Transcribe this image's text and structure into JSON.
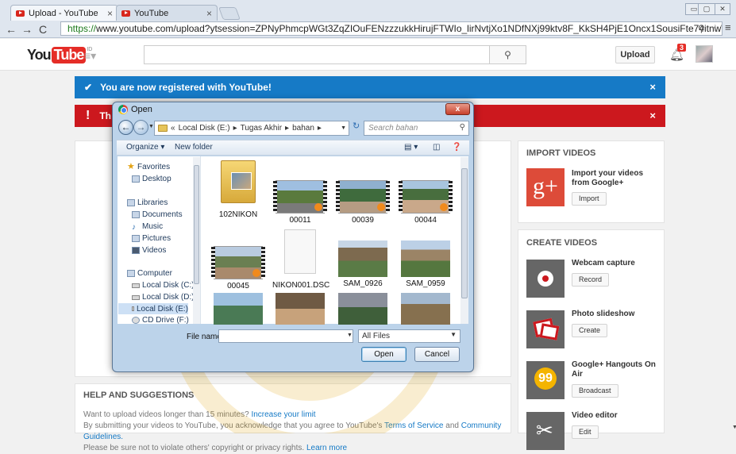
{
  "browser": {
    "tabs": [
      {
        "title": "Upload - YouTube",
        "active": true
      },
      {
        "title": "YouTube",
        "active": false
      }
    ],
    "url_https": "https://",
    "url_rest": "www.youtube.com/upload?ytsession=ZPNyPhmcpWGt3ZqZIOuFENzzzukkHirujFTWIo_lirNvtjXo1NDfNXj99ktv8F_KkSH4PjE1Oncx1SousiFte74itnwWRAR9_dBNI",
    "window_controls": [
      "▭",
      "▢",
      "✕"
    ]
  },
  "youtube": {
    "logo_you": "You",
    "logo_tube": "Tube",
    "logo_country": "ID",
    "search_placeholder": "",
    "upload_label": "Upload",
    "notification_count": "3"
  },
  "banners": {
    "registered": "You are now registered with YouTube!",
    "warning_visible": "Th"
  },
  "import": {
    "title": "IMPORT VIDEOS",
    "gplus_title": "Import your videos from Google+",
    "gplus_button": "Import"
  },
  "create": {
    "title": "CREATE VIDEOS",
    "items": [
      {
        "title": "Webcam capture",
        "button": "Record"
      },
      {
        "title": "Photo slideshow",
        "button": "Create"
      },
      {
        "title": "Google+ Hangouts On Air",
        "button": "Broadcast"
      },
      {
        "title": "Video editor",
        "button": "Edit"
      }
    ]
  },
  "help": {
    "title": "HELP AND SUGGESTIONS",
    "line1_text": "Want to upload videos longer than 15 minutes?",
    "line1_link": "Increase your limit",
    "line2_text": "By submitting your videos to YouTube, you acknowledge that you agree to YouTube's",
    "line2_link1": "Terms of Service",
    "line2_and": "and",
    "line2_link2": "Community Guidelines.",
    "line3_text": "Please be sure not to violate others' copyright or privacy rights.",
    "line3_link": "Learn more"
  },
  "dialog": {
    "title": "Open",
    "close": "x",
    "path": [
      "Local Disk (E:)",
      "Tugas Akhir",
      "bahan"
    ],
    "search_placeholder": "Search bahan",
    "organize": "Organize ▾",
    "new_folder": "New folder",
    "nav": {
      "favorites": "Favorites",
      "desktop": "Desktop",
      "libraries": "Libraries",
      "documents": "Documents",
      "music": "Music",
      "pictures": "Pictures",
      "videos": "Videos",
      "computer": "Computer",
      "drive_c": "Local Disk (C:)",
      "drive_d": "Local Disk (D:)",
      "drive_e": "Local Disk (E:)",
      "drive_f": "CD Drive (F:)"
    },
    "files": [
      "102NIKON",
      "00011",
      "00039",
      "00044",
      "00045",
      "NIKON001.DSC",
      "SAM_0926",
      "SAM_0959"
    ],
    "file_name_label": "File name:",
    "file_name_value": "",
    "file_type": "All Files",
    "open_label": "Open",
    "cancel_label": "Cancel"
  },
  "colors": {
    "youtube_red": "#e52d27",
    "banner_blue": "#167ac6",
    "banner_red": "#cc181e",
    "gplus_red": "#dd4b39",
    "hangouts_yellow": "#f4b400"
  }
}
